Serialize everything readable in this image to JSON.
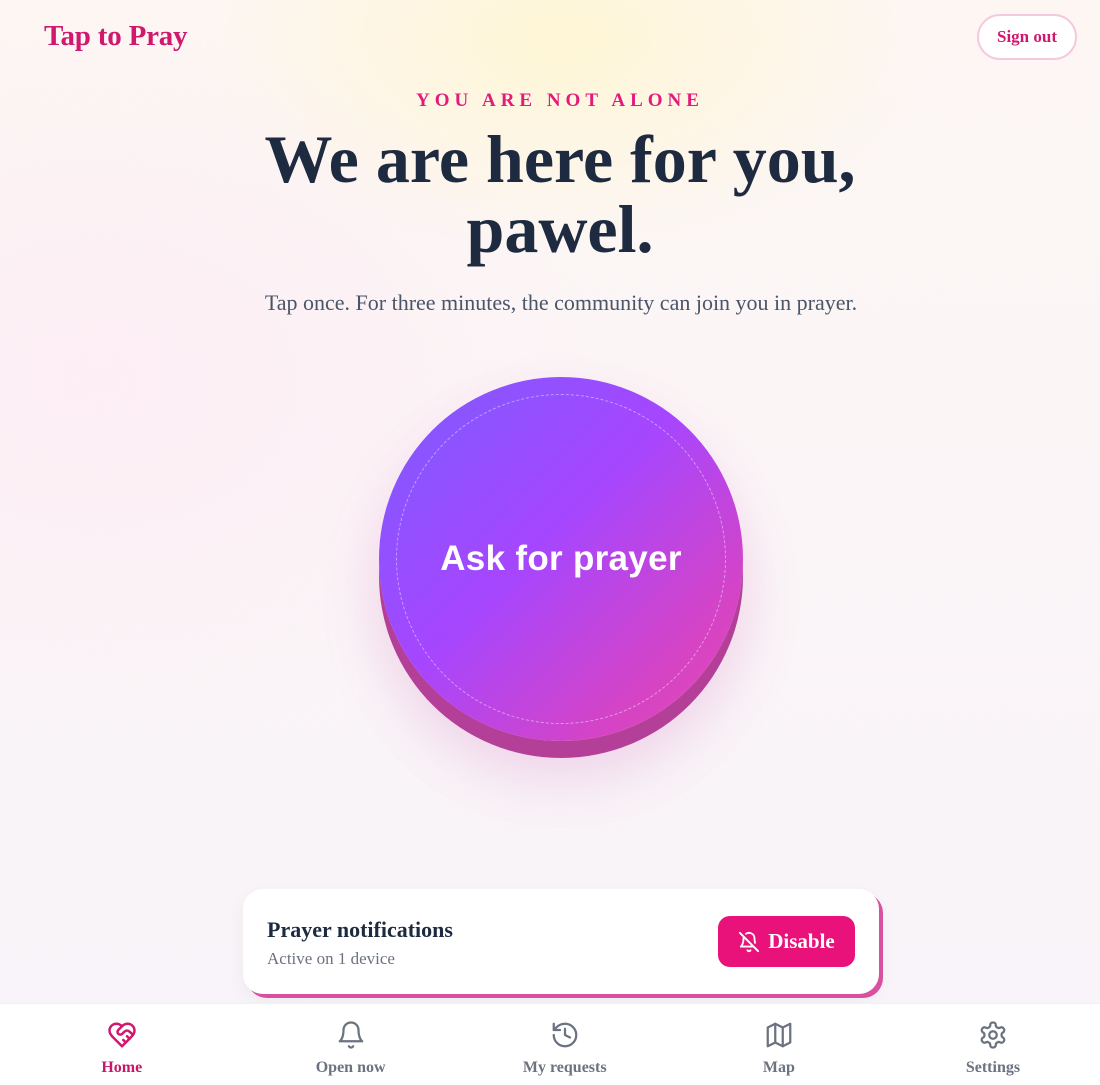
{
  "app": {
    "title": "Tap to Pray",
    "sign_out_label": "Sign out"
  },
  "hero": {
    "eyebrow": "YOU ARE NOT ALONE",
    "headline_line1": "We are here for you,",
    "headline_line2": "pawel.",
    "subtitle": "Tap once. For three minutes, the community can join you in prayer."
  },
  "prayer_button": {
    "label": "Ask for prayer"
  },
  "notifications": {
    "title": "Prayer notifications",
    "status": "Active on 1 device",
    "action_label": "Disable",
    "action_icon": "bell-off-icon"
  },
  "tabs": [
    {
      "label": "Home",
      "icon": "heart-handshake-icon",
      "active": true
    },
    {
      "label": "Open now",
      "icon": "bell-icon",
      "active": false
    },
    {
      "label": "My requests",
      "icon": "history-icon",
      "active": false
    },
    {
      "label": "Map",
      "icon": "map-icon",
      "active": false
    },
    {
      "label": "Settings",
      "icon": "gear-icon",
      "active": false
    }
  ],
  "colors": {
    "brand": "#d0186f",
    "accent": "#e8127a",
    "button_gradient_start": "#7b5cff",
    "button_gradient_end": "#e64ab2",
    "text_dark": "#1e2a3f",
    "text_muted": "#6b7280"
  }
}
